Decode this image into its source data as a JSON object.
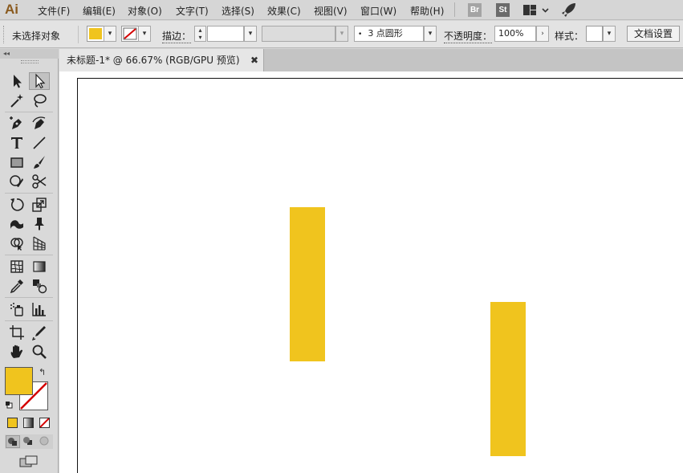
{
  "app": {
    "logo": "Ai"
  },
  "menu": [
    {
      "id": "file",
      "label": "文件(F)"
    },
    {
      "id": "edit",
      "label": "编辑(E)"
    },
    {
      "id": "object",
      "label": "对象(O)"
    },
    {
      "id": "type",
      "label": "文字(T)"
    },
    {
      "id": "select",
      "label": "选择(S)"
    },
    {
      "id": "effect",
      "label": "效果(C)"
    },
    {
      "id": "view",
      "label": "视图(V)"
    },
    {
      "id": "window",
      "label": "窗口(W)"
    },
    {
      "id": "help",
      "label": "帮助(H)"
    }
  ],
  "menubar_icons": {
    "bridge": "Br",
    "stock": "St",
    "workspace_icon": "workspace-grid-icon",
    "rocket_icon": "rocket-icon"
  },
  "control": {
    "selection_status": "未选择对象",
    "fill_color": "#F0C41E",
    "stroke_color": "none",
    "stroke_label": "描边：",
    "stroke_weight": "",
    "brush_profile": "",
    "brush_value": "3 点圆形",
    "opacity_label": "不透明度：",
    "opacity_value": "100%",
    "style_label": "样式：",
    "doc_setup_button": "文档设置"
  },
  "document": {
    "tab_title": "未标题-1* @ 66.67% (RGB/GPU 预览)",
    "close_glyph": "✖",
    "shapes": [
      {
        "name": "yellow-rectangle-1",
        "fill": "#F0C41E"
      },
      {
        "name": "yellow-rectangle-2",
        "fill": "#F0C41E"
      }
    ]
  },
  "toolbar": {
    "header_glyph": "◂◂",
    "swap_glyph": "↰",
    "fill_color": "#F0C41E",
    "tools": [
      "selection-tool",
      "direct-selection-tool",
      "magic-wand-tool",
      "lasso-tool",
      "pen-tool",
      "curvature-tool",
      "type-tool",
      "line-segment-tool",
      "rectangle-tool",
      "paintbrush-tool",
      "shaper-tool",
      "scissors-tool",
      "rotate-tool",
      "scale-tool",
      "width-tool",
      "free-transform-tool",
      "shape-builder-tool",
      "perspective-grid-tool",
      "mesh-tool",
      "gradient-tool",
      "eyedropper-tool",
      "blend-tool",
      "symbol-sprayer-tool",
      "column-graph-tool",
      "artboard-tool",
      "slice-tool",
      "hand-tool",
      "zoom-tool"
    ]
  }
}
